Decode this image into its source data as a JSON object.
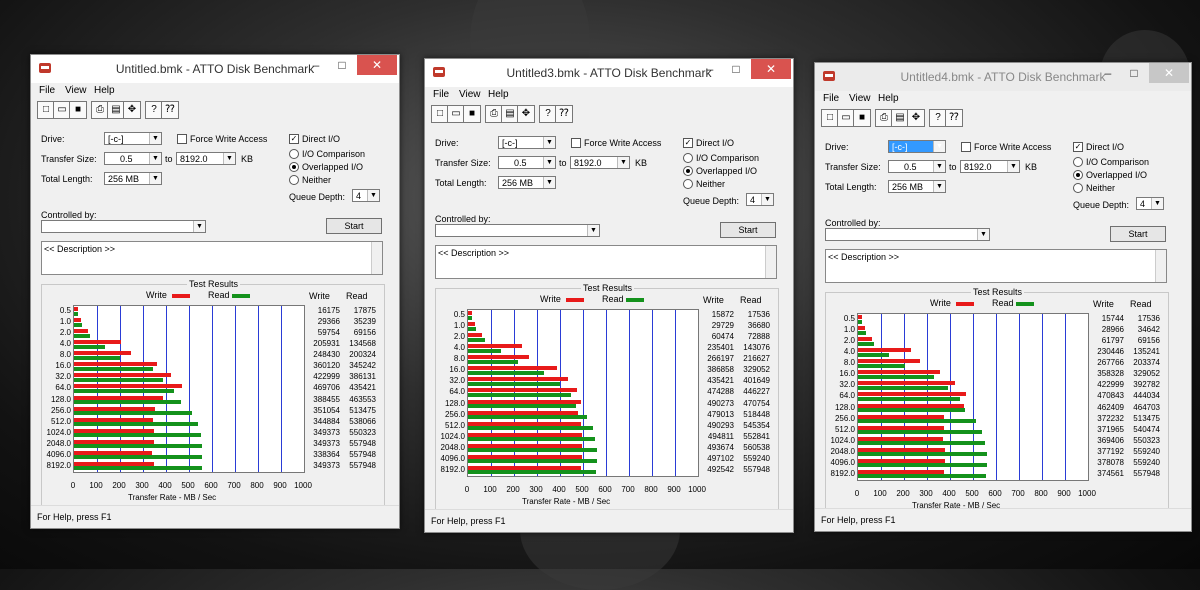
{
  "windows": [
    {
      "title": "Untitled.bmk - ATTO Disk Benchmark",
      "state": "active",
      "drive": "[-c-]",
      "transfer_size_from": "0.5",
      "transfer_size_to": "8192.0",
      "transfer_size_unit": "KB",
      "total_length": "256 MB",
      "queue_depth": "4",
      "results": {
        "write": [
          16175,
          29366,
          59754,
          205931,
          248430,
          360120,
          422999,
          469706,
          388455,
          351054,
          344884,
          349373,
          349373,
          338364,
          349373
        ],
        "read": [
          17875,
          35239,
          69156,
          134568,
          200324,
          345242,
          386131,
          435421,
          463553,
          513475,
          538066,
          550323,
          557948,
          557948,
          557948
        ]
      }
    },
    {
      "title": "Untitled3.bmk - ATTO Disk Benchmark",
      "state": "active",
      "drive": "[-c-]",
      "transfer_size_from": "0.5",
      "transfer_size_to": "8192.0",
      "transfer_size_unit": "KB",
      "total_length": "256 MB",
      "queue_depth": "4",
      "results": {
        "write": [
          15872,
          29729,
          60474,
          235401,
          266197,
          386858,
          435421,
          474288,
          490273,
          479013,
          490293,
          494811,
          493674,
          497102,
          492542
        ],
        "read": [
          17536,
          36680,
          72888,
          143076,
          216627,
          329052,
          401649,
          446227,
          470754,
          518448,
          545354,
          552841,
          560538,
          559240,
          557948
        ]
      }
    },
    {
      "title": "Untitled4.bmk - ATTO Disk Benchmark",
      "state": "inactive",
      "drive": "[-c-]",
      "transfer_size_from": "0.5",
      "transfer_size_to": "8192.0",
      "transfer_size_unit": "KB",
      "total_length": "256 MB",
      "queue_depth": "4",
      "results": {
        "write": [
          15744,
          28966,
          61797,
          230446,
          267766,
          358328,
          422999,
          470843,
          462409,
          372232,
          371965,
          369406,
          377192,
          378078,
          374561
        ],
        "read": [
          17536,
          34642,
          69156,
          135241,
          203374,
          329052,
          392782,
          444034,
          464703,
          513475,
          540474,
          550323,
          559240,
          559240,
          557948
        ]
      }
    }
  ],
  "labels": {
    "menu_file": "File",
    "menu_view": "View",
    "menu_help": "Help",
    "drive": "Drive:",
    "transfer_size": "Transfer Size:",
    "to": "to",
    "total_length": "Total Length:",
    "force_write_access": "Force Write Access",
    "direct_io": "Direct I/O",
    "io_comparison": "I/O Comparison",
    "overlapped_io": "Overlapped I/O",
    "neither": "Neither",
    "queue_depth": "Queue Depth:",
    "controlled_by": "Controlled by:",
    "start": "Start",
    "description": "<< Description >>",
    "test_results": "Test Results",
    "write": "Write",
    "read": "Read",
    "x_axis_title": "Transfer Rate - MB / Sec",
    "status": "For Help, press F1",
    "minimize": "–",
    "maximize": "□",
    "close": "✕"
  },
  "chart_data": [
    {
      "type": "bar",
      "orientation": "horizontal",
      "title": "Test Results",
      "xlabel": "Transfer Rate - MB / Sec",
      "xlim": [
        0,
        1000
      ],
      "categories": [
        "0.5",
        "1.0",
        "2.0",
        "4.0",
        "8.0",
        "16.0",
        "32.0",
        "64.0",
        "128.0",
        "256.0",
        "512.0",
        "1024.0",
        "2048.0",
        "4096.0",
        "8192.0"
      ],
      "series": [
        {
          "name": "Write",
          "color": "#e81a1a",
          "values": [
            16175,
            29366,
            59754,
            205931,
            248430,
            360120,
            422999,
            469706,
            388455,
            351054,
            344884,
            349373,
            349373,
            338364,
            349373
          ]
        },
        {
          "name": "Read",
          "color": "#14921c",
          "values": [
            17875,
            35239,
            69156,
            134568,
            200324,
            345242,
            386131,
            435421,
            463553,
            513475,
            538066,
            550323,
            557948,
            557948,
            557948
          ]
        }
      ]
    },
    {
      "type": "bar",
      "orientation": "horizontal",
      "title": "Test Results",
      "xlabel": "Transfer Rate - MB / Sec",
      "xlim": [
        0,
        1000
      ],
      "categories": [
        "0.5",
        "1.0",
        "2.0",
        "4.0",
        "8.0",
        "16.0",
        "32.0",
        "64.0",
        "128.0",
        "256.0",
        "512.0",
        "1024.0",
        "2048.0",
        "4096.0",
        "8192.0"
      ],
      "series": [
        {
          "name": "Write",
          "color": "#e81a1a",
          "values": [
            15872,
            29729,
            60474,
            235401,
            266197,
            386858,
            435421,
            474288,
            490273,
            479013,
            490293,
            494811,
            493674,
            497102,
            492542
          ]
        },
        {
          "name": "Read",
          "color": "#14921c",
          "values": [
            17536,
            36680,
            72888,
            143076,
            216627,
            329052,
            401649,
            446227,
            470754,
            518448,
            545354,
            552841,
            560538,
            559240,
            557948
          ]
        }
      ]
    },
    {
      "type": "bar",
      "orientation": "horizontal",
      "title": "Test Results",
      "xlabel": "Transfer Rate - MB / Sec",
      "xlim": [
        0,
        1000
      ],
      "categories": [
        "0.5",
        "1.0",
        "2.0",
        "4.0",
        "8.0",
        "16.0",
        "32.0",
        "64.0",
        "128.0",
        "256.0",
        "512.0",
        "1024.0",
        "2048.0",
        "4096.0",
        "8192.0"
      ],
      "series": [
        {
          "name": "Write",
          "color": "#e81a1a",
          "values": [
            15744,
            28966,
            61797,
            230446,
            267766,
            358328,
            422999,
            470843,
            462409,
            372232,
            371965,
            369406,
            377192,
            378078,
            374561
          ]
        },
        {
          "name": "Read",
          "color": "#14921c",
          "values": [
            17536,
            34642,
            69156,
            135241,
            203374,
            329052,
            392782,
            444034,
            464703,
            513475,
            540474,
            550323,
            559240,
            559240,
            557948
          ]
        }
      ]
    }
  ],
  "categories": [
    "0.5",
    "1.0",
    "2.0",
    "4.0",
    "8.0",
    "16.0",
    "32.0",
    "64.0",
    "128.0",
    "256.0",
    "512.0",
    "1024.0",
    "2048.0",
    "4096.0",
    "8192.0"
  ],
  "x_ticks": [
    "0",
    "100",
    "200",
    "300",
    "400",
    "500",
    "600",
    "700",
    "800",
    "900",
    "1000"
  ]
}
